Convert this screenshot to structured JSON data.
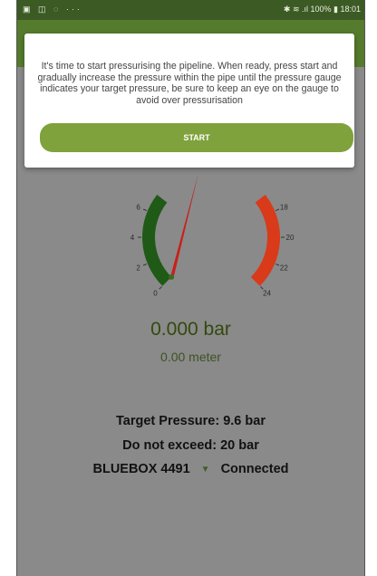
{
  "status_bar": {
    "left_icons": "▣ ◫ ◌ ···",
    "right_text": "✱ ≋ .ıl 100% ▮ 18:01"
  },
  "dialog": {
    "message": "It's time to start pressurising the pipeline. When ready, press start and gradually increase the pressure within the pipe until the pressure gauge indicates your target pressure, be sure to keep an eye on the gauge to avoid over pressurisation",
    "start_label": "START"
  },
  "gauge": {
    "min": 0,
    "max": 24,
    "value": 11,
    "visible_ticks": [
      "0",
      "2",
      "4",
      "6",
      "18",
      "20",
      "22",
      "24"
    ]
  },
  "reading": {
    "bar": "0.000 bar",
    "meter": "0.00 meter"
  },
  "info": {
    "target": "Target Pressure: 9.6 bar",
    "exceed": "Do not exceed: 20 bar",
    "device": "BLUEBOX 4491",
    "bt_icon": "bluetooth-icon",
    "connection": "Connected"
  },
  "colors": {
    "status_bar": "#3c5a24",
    "app_bar": "#557b2d",
    "start_button": "#7fa23c",
    "gauge_low": "#1f5a16",
    "gauge_high": "#d83a1a",
    "needle": "#c8201a",
    "background_dim": "#8a8a8a"
  }
}
